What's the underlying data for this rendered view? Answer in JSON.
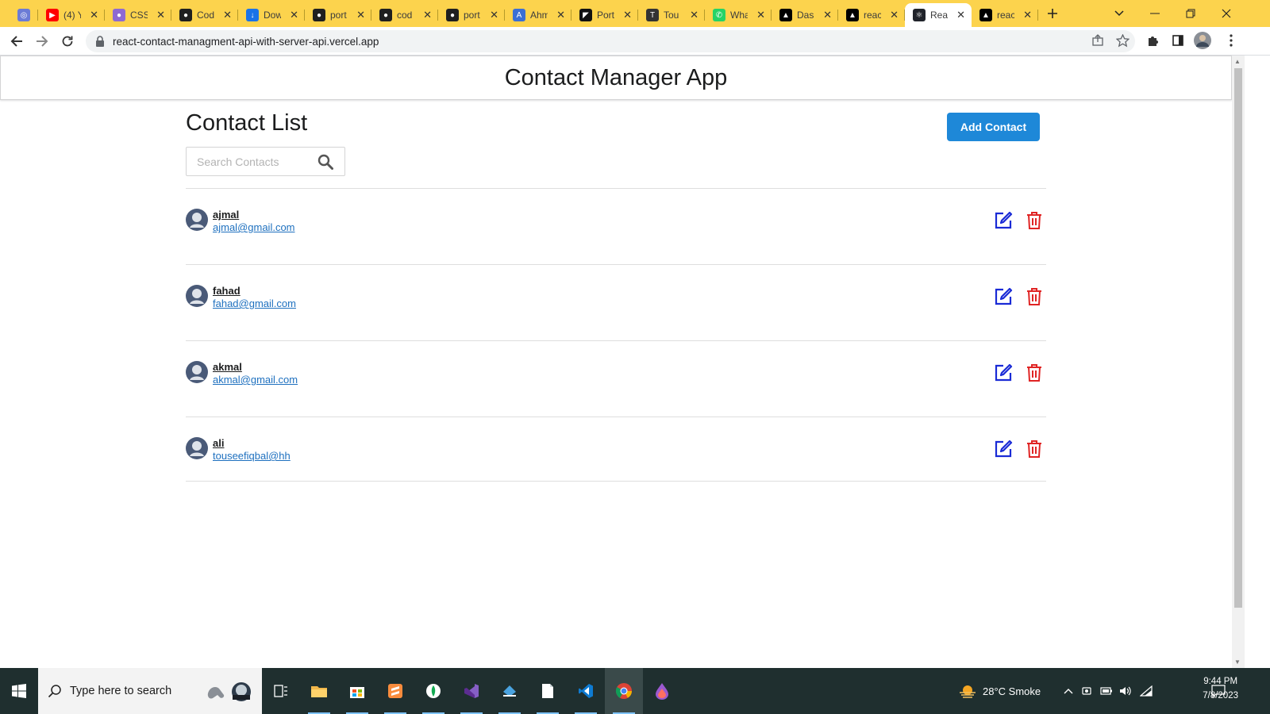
{
  "browser": {
    "tabs": [
      {
        "title": "",
        "color": "#6b7bd6",
        "glyph": "◎"
      },
      {
        "title": "(4) Y",
        "color": "#ff0000",
        "glyph": "▶"
      },
      {
        "title": "CSS",
        "color": "#8e6ad1",
        "glyph": "●"
      },
      {
        "title": "Cod",
        "color": "#1f1f1f",
        "glyph": "●"
      },
      {
        "title": "Dow",
        "color": "#1a73e8",
        "glyph": "↓"
      },
      {
        "title": "port",
        "color": "#1f1f1f",
        "glyph": "●"
      },
      {
        "title": "cod",
        "color": "#1f1f1f",
        "glyph": "●"
      },
      {
        "title": "port",
        "color": "#1f1f1f",
        "glyph": "●"
      },
      {
        "title": "Ahm",
        "color": "#3b6fd4",
        "glyph": "A"
      },
      {
        "title": "Port",
        "color": "#111111",
        "glyph": "◤"
      },
      {
        "title": "Tou",
        "color": "#333333",
        "glyph": "T"
      },
      {
        "title": "Wha",
        "color": "#25d366",
        "glyph": "✆"
      },
      {
        "title": "Das",
        "color": "#000000",
        "glyph": "▲"
      },
      {
        "title": "reac",
        "color": "#000000",
        "glyph": "▲"
      },
      {
        "title": "Rea",
        "color": "#20232a",
        "glyph": "⚛",
        "active": true
      },
      {
        "title": "reac",
        "color": "#000000",
        "glyph": "▲"
      }
    ],
    "url": "react-contact-managment-api-with-server-api.vercel.app"
  },
  "app": {
    "header_title": "Contact Manager App",
    "list_title": "Contact List",
    "add_button": "Add Contact",
    "search_placeholder": "Search Contacts",
    "contacts": [
      {
        "name": "ajmal",
        "email": "ajmal@gmail.com"
      },
      {
        "name": "fahad",
        "email": "fahad@gmail.com"
      },
      {
        "name": "akmal",
        "email": "akmal@gmail.com"
      },
      {
        "name": "ali",
        "email": "touseefiqbal@hh"
      }
    ],
    "colors": {
      "primary": "#1e88d8",
      "edit_icon": "#1a2bd6",
      "delete_icon": "#e02424",
      "link": "#1e70bf"
    }
  },
  "taskbar": {
    "search_placeholder": "Type here to search",
    "weather": "28°C  Smoke",
    "time": "9:44 PM",
    "date": "7/8/2023"
  }
}
